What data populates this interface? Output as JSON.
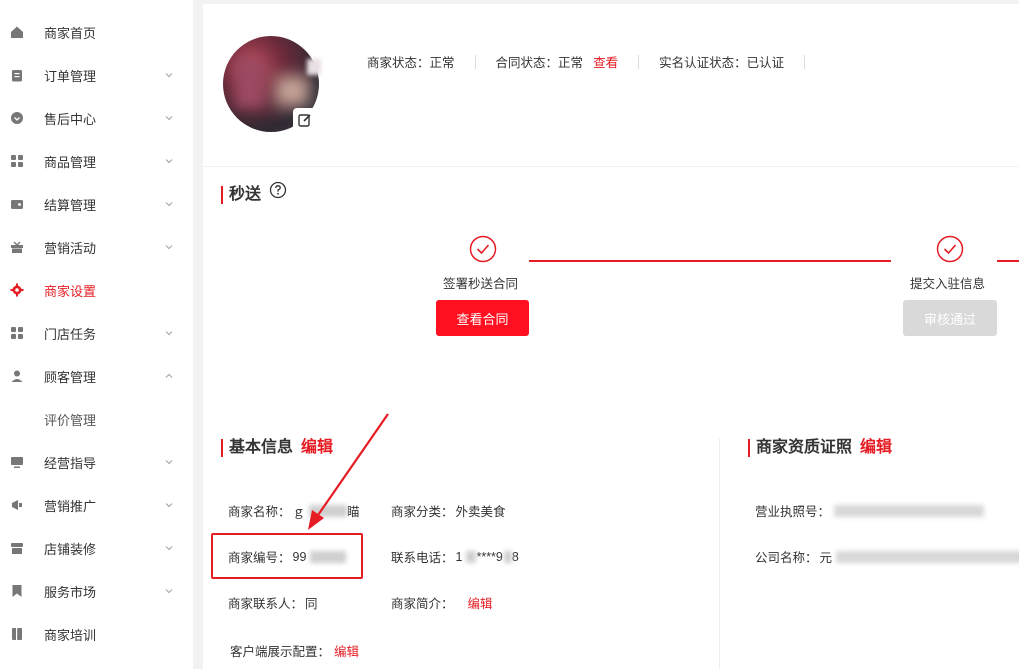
{
  "sidebar": {
    "items": [
      {
        "label": "商家首页",
        "icon": "home-icon",
        "chevron": false
      },
      {
        "label": "订单管理",
        "icon": "clipboard-icon",
        "chevron": true
      },
      {
        "label": "售后中心",
        "icon": "heart-shield-icon",
        "chevron": true
      },
      {
        "label": "商品管理",
        "icon": "grid-icon",
        "chevron": true
      },
      {
        "label": "结算管理",
        "icon": "wallet-icon",
        "chevron": true
      },
      {
        "label": "营销活动",
        "icon": "gift-icon",
        "chevron": true
      },
      {
        "label": "商家设置",
        "icon": "gear-icon",
        "chevron": false,
        "active": true
      },
      {
        "label": "门店任务",
        "icon": "grid-icon",
        "chevron": true
      },
      {
        "label": "顾客管理",
        "icon": "user-group-icon",
        "chevron": true,
        "expanded": true
      },
      {
        "label": "评价管理",
        "sub": true
      },
      {
        "label": "经营指导",
        "icon": "monitor-icon",
        "chevron": true
      },
      {
        "label": "营销推广",
        "icon": "megaphone-icon",
        "chevron": true
      },
      {
        "label": "店铺装修",
        "icon": "store-icon",
        "chevron": true
      },
      {
        "label": "服务市场",
        "icon": "bookmark-icon",
        "chevron": true
      },
      {
        "label": "商家培训",
        "icon": "book-icon",
        "chevron": false
      }
    ]
  },
  "status": {
    "merchant_status_label": "商家状态：",
    "merchant_status_value": "正常",
    "contract_status_label": "合同状态：",
    "contract_status_value": "正常",
    "contract_view_link": "查看",
    "verify_status_label": "实名认证状态：",
    "verify_status_value": "已认证"
  },
  "miaosong": {
    "title": "秒送",
    "steps": [
      {
        "label": "签署秒送合同",
        "button": "查看合同",
        "button_state": "active"
      },
      {
        "label": "提交入驻信息",
        "button": "审核通过",
        "button_state": "disabled"
      }
    ]
  },
  "basic_info": {
    "title": "基本信息",
    "edit": "编辑",
    "name_label": "商家名称：",
    "name_value": "ｇ",
    "name_value_tail": "瞄",
    "category_label": "商家分类：",
    "category_value": "外卖美食",
    "id_label": "商家编号：",
    "id_value": "99",
    "phone_label": "联系电话：",
    "phone_value": "1",
    "phone_mask": "****9",
    "phone_tail": "8",
    "contact_label": "商家联系人：",
    "contact_value": "同",
    "intro_label": "商家简介：",
    "intro_edit": "编辑",
    "client_config_label": "客户端展示配置：",
    "client_config_edit": "编辑"
  },
  "qualification": {
    "title": "商家资质证照",
    "edit": "编辑",
    "license_label": "营业执照号：",
    "company_label": "公司名称：",
    "company_value": "元"
  },
  "colors": {
    "accent": "#e51c23",
    "button_red": "#ff0f1f",
    "button_disabled": "#d9d9d9"
  }
}
